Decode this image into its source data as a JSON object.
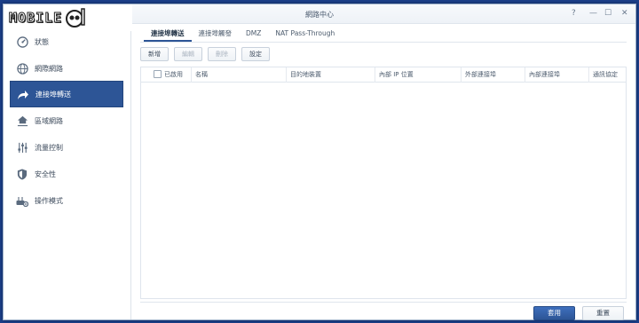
{
  "watermark": {
    "text": "MOBILE"
  },
  "window": {
    "title": "網路中心",
    "controls": {
      "help": "?",
      "minimize": "—",
      "maximize": "☐",
      "close": "✕"
    }
  },
  "sidebar": {
    "items": [
      {
        "label": "狀態",
        "icon": "dashboard-icon"
      },
      {
        "label": "網際網路",
        "icon": "globe-icon"
      },
      {
        "label": "連接埠轉送",
        "icon": "share-arrow-icon",
        "active": true
      },
      {
        "label": "區域網路",
        "icon": "house-network-icon"
      },
      {
        "label": "流量控制",
        "icon": "sliders-icon"
      },
      {
        "label": "安全性",
        "icon": "shield-icon"
      },
      {
        "label": "操作模式",
        "icon": "router-gear-icon"
      }
    ]
  },
  "tabs": [
    {
      "label": "連接埠轉送",
      "active": true
    },
    {
      "label": "連接埠觸發"
    },
    {
      "label": "DMZ"
    },
    {
      "label": "NAT Pass-Through"
    }
  ],
  "toolbar": {
    "add": "新增",
    "edit": "編輯",
    "delete": "刪除",
    "settings": "設定"
  },
  "grid": {
    "columns": [
      "已啟用",
      "名稱",
      "目的地裝置",
      "內部 IP 位置",
      "外部連接埠",
      "內部連接埠",
      "通訊協定"
    ],
    "rows": []
  },
  "footer": {
    "apply": "套用",
    "reset": "重置"
  },
  "colors": {
    "accent": "#2d5596",
    "desktop": "#1c3f8a"
  }
}
